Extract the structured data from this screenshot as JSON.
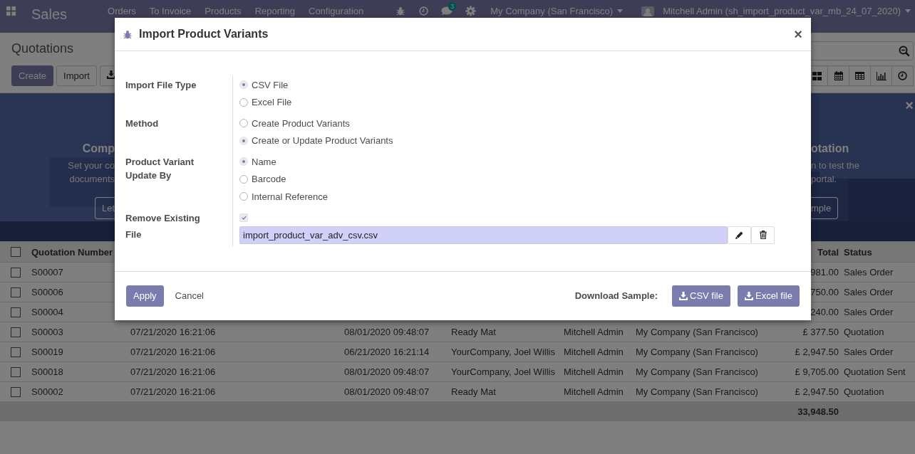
{
  "navbar": {
    "app": "Sales",
    "menu": [
      "Orders",
      "To Invoice",
      "Products",
      "Reporting",
      "Configuration"
    ],
    "message_count": "3",
    "company": "My Company (San Francisco)",
    "user": "Mitchell Admin (sh_import_product_var_mb_24_07_2020)"
  },
  "control_panel": {
    "title": "Quotations",
    "buttons": [
      "Create",
      "Import"
    ]
  },
  "banner": {
    "left_lines": [
      "Comp",
      "Set your co",
      "documents"
    ],
    "left_button": "Let",
    "right_lines": [
      "otation",
      "n to test the",
      "portal."
    ],
    "right_button": "mple",
    "close": "×"
  },
  "table": {
    "header": {
      "number": "Quotation Number",
      "total": "Total",
      "status": "Status",
      "checked": false
    },
    "rows": [
      {
        "number": "S00007",
        "total": "981.00",
        "status": "Sales Order",
        "checked": false
      },
      {
        "number": "S00006",
        "total": "750.00",
        "status": "Sales Order",
        "checked": false
      },
      {
        "number": "S00004",
        "total": "240.00",
        "status": "Sales Order",
        "checked": false
      },
      {
        "number": "S00003",
        "created": "07/21/2020 16:21:06",
        "date": "08/01/2020 09:48:07",
        "customer": "Ready Mat",
        "salesperson": "Mitchell Admin",
        "company": "My Company (San Francisco)",
        "total": "£ 377.50",
        "status": "Quotation",
        "checked": false
      },
      {
        "number": "S00019",
        "created": "07/21/2020 16:21:06",
        "date": "06/21/2020 16:21:14",
        "customer": "YourCompany, Joel Willis",
        "salesperson": "Mitchell Admin",
        "company": "My Company (San Francisco)",
        "total": "£ 2,947.50",
        "status": "Sales Order",
        "checked": false
      },
      {
        "number": "S00018",
        "created": "07/21/2020 16:21:06",
        "date": "08/01/2020 09:48:07",
        "customer": "YourCompany, Joel Willis",
        "salesperson": "Mitchell Admin",
        "company": "My Company (San Francisco)",
        "total": "£ 9,705.00",
        "status": "Quotation Sent",
        "checked": false
      },
      {
        "number": "S00002",
        "created": "07/21/2020 16:21:06",
        "date": "08/01/2020 09:48:07",
        "customer": "Ready Mat",
        "salesperson": "Mitchell Admin",
        "company": "My Company (San Francisco)",
        "total": "£ 2,947.50",
        "status": "Quotation",
        "checked": false
      }
    ],
    "sum": "33,948.50"
  },
  "dialog": {
    "title": "Import Product Variants",
    "close": "×",
    "fields": [
      {
        "label": "Import File Type",
        "kind": "radio",
        "options": [
          {
            "label": "CSV File",
            "selected": true
          },
          {
            "label": "Excel File",
            "selected": false
          }
        ]
      },
      {
        "label": "Method",
        "kind": "radio",
        "options": [
          {
            "label": "Create Product Variants",
            "selected": false
          },
          {
            "label": "Create or Update Product Variants",
            "selected": true
          }
        ]
      },
      {
        "label": "Product Variant Update By",
        "kind": "radio",
        "options": [
          {
            "label": "Name",
            "selected": true
          },
          {
            "label": "Barcode",
            "selected": false
          },
          {
            "label": "Internal Reference",
            "selected": false
          }
        ]
      },
      {
        "label": "Remove Existing",
        "kind": "checkbox",
        "checked": true
      },
      {
        "label": "File",
        "kind": "file",
        "value": "import_product_var_adv_csv.csv"
      }
    ],
    "apply": "Apply",
    "cancel": "Cancel",
    "download_label": "Download Sample:",
    "download_buttons": [
      "CSV file",
      "Excel file"
    ]
  }
}
